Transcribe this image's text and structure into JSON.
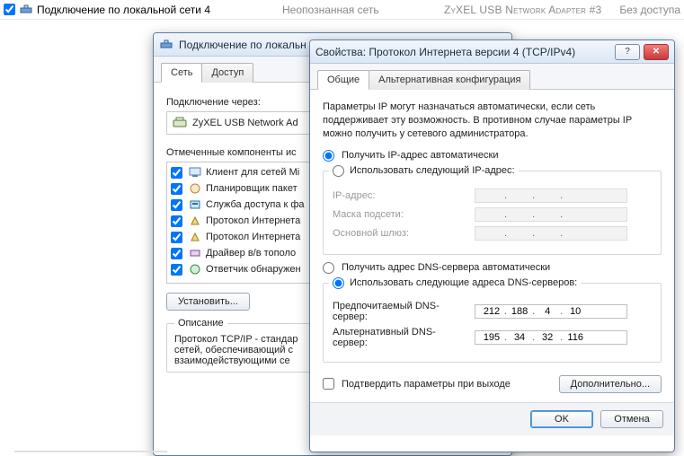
{
  "connection_row": {
    "checked": true,
    "name": "Подключение по локальной сети 4",
    "status": "Неопознанная сеть",
    "adapter": "ZyXEL USB Network Adapter #3",
    "access": "Без доступа"
  },
  "back_window": {
    "title": "Подключение по локальн",
    "tabs": {
      "net": "Сеть",
      "access": "Доступ"
    },
    "connect_via_label": "Подключение через:",
    "adapter_name": "ZyXEL USB Network Ad",
    "components_label": "Отмеченные компоненты ис",
    "items": [
      {
        "label": "Клиент для сетей Mi",
        "checked": true
      },
      {
        "label": "Планировщик пакет",
        "checked": true
      },
      {
        "label": "Служба доступа к фа",
        "checked": true
      },
      {
        "label": "Протокол Интернета",
        "checked": true
      },
      {
        "label": "Протокол Интернета",
        "checked": true
      },
      {
        "label": "Драйвер в/в тополо",
        "checked": true
      },
      {
        "label": "Ответчик обнаружен",
        "checked": true
      }
    ],
    "install_btn": "Установить...",
    "desc_legend": "Описание",
    "desc_text": "Протокол TCP/IP - стандар\nсетей, обеспечивающий с\nвзаимодействующими се"
  },
  "front_window": {
    "title": "Свойства: Протокол Интернета версии 4 (TCP/IPv4)",
    "tabs": {
      "general": "Общие",
      "alt": "Альтернативная конфигурация"
    },
    "desc": "Параметры IP могут назначаться автоматически, если сеть поддерживает эту возможность. В противном случае параметры IP можно получить у сетевого администратора.",
    "ip": {
      "auto": "Получить IP-адрес автоматически",
      "manual": "Использовать следующий IP-адрес:",
      "selected": "auto",
      "addr_label": "IP-адрес:",
      "mask_label": "Маска подсети:",
      "gw_label": "Основной шлюз:"
    },
    "dns": {
      "auto": "Получить адрес DNS-сервера автоматически",
      "manual": "Использовать следующие адреса DNS-серверов:",
      "selected": "manual",
      "pref_label": "Предпочитаемый DNS-сервер:",
      "alt_label": "Альтернативный DNS-сервер:",
      "pref_value": [
        "212",
        "188",
        "4",
        "10"
      ],
      "alt_value": [
        "195",
        "34",
        "32",
        "116"
      ]
    },
    "confirm_exit": "Подтвердить параметры при выходе",
    "advanced_btn": "Дополнительно...",
    "ok_btn": "OK",
    "cancel_btn": "Отмена"
  }
}
